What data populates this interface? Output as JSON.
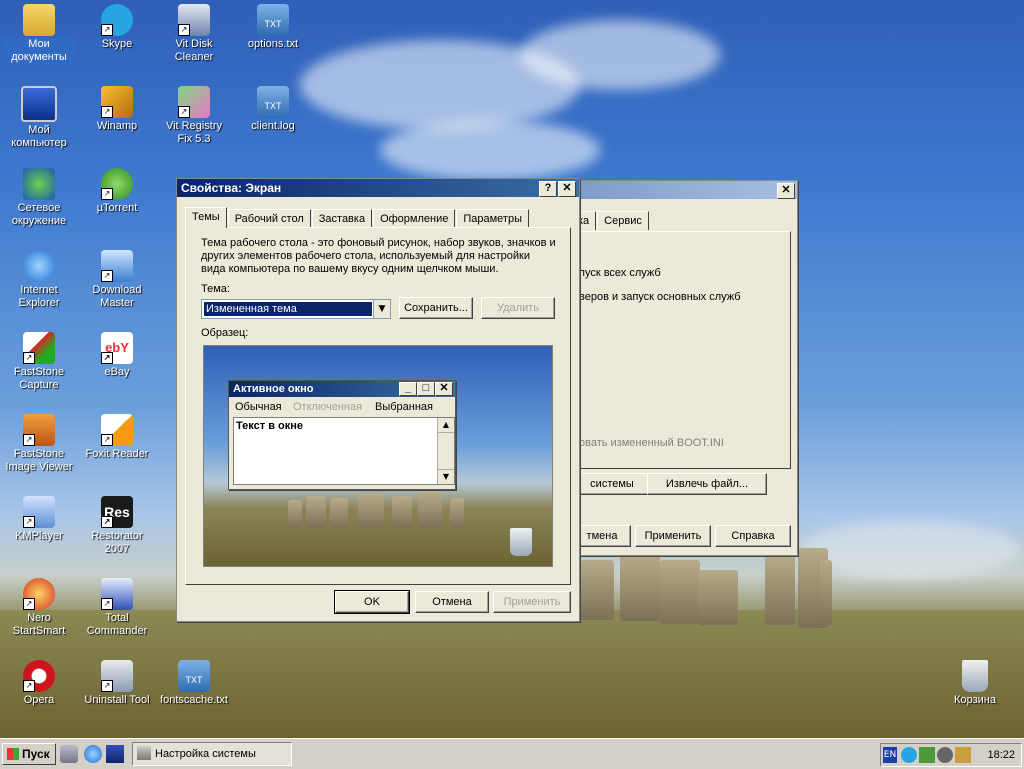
{
  "desktop_icons": [
    {
      "label": "Мои документы",
      "icon": "folder-documents-icon"
    },
    {
      "label": "Skype",
      "icon": "skype-icon"
    },
    {
      "label": "Vit Disk Cleaner",
      "icon": "disk-cleaner-icon"
    },
    {
      "label": "options.txt",
      "icon": "text-file-icon"
    },
    {
      "label": "Мой компьютер",
      "icon": "my-computer-icon"
    },
    {
      "label": "Winamp",
      "icon": "winamp-icon"
    },
    {
      "label": "Vit Registry Fix 5.3",
      "icon": "registry-fix-icon"
    },
    {
      "label": "client.log",
      "icon": "text-file-icon"
    },
    {
      "label": "Сетевое окружение",
      "icon": "network-icon"
    },
    {
      "label": "µTorrent",
      "icon": "utorrent-icon"
    },
    {
      "label": "Internet Explorer",
      "icon": "internet-explorer-icon"
    },
    {
      "label": "Download Master",
      "icon": "download-master-icon"
    },
    {
      "label": "FastStone Capture",
      "icon": "faststone-capture-icon"
    },
    {
      "label": "eBay",
      "icon": "ebay-icon"
    },
    {
      "label": "FastStone Image Viewer",
      "icon": "faststone-viewer-icon"
    },
    {
      "label": "Foxit Reader",
      "icon": "foxit-reader-icon"
    },
    {
      "label": "KMPlayer",
      "icon": "kmplayer-icon"
    },
    {
      "label": "Restorator 2007",
      "icon": "restorator-icon"
    },
    {
      "label": "Nero StartSmart",
      "icon": "nero-icon"
    },
    {
      "label": "Total Commander",
      "icon": "total-commander-icon"
    },
    {
      "label": "Opera",
      "icon": "opera-icon"
    },
    {
      "label": "Uninstall Tool",
      "icon": "uninstall-tool-icon"
    },
    {
      "label": "fontscache.txt",
      "icon": "text-file-icon"
    },
    {
      "label": "Корзина",
      "icon": "recycle-bin-icon"
    }
  ],
  "bg_window": {
    "tab_partial": "ка",
    "tab_service": "Сервис",
    "line1": "пуск всех служб",
    "line2": "веров и запуск основных служб",
    "line3": "овать измененный BOOT.INI",
    "btn_system": "системы",
    "btn_extract": "Извлечь файл...",
    "btn_cancel_partial": "тмена",
    "btn_apply": "Применить",
    "btn_help": "Справка"
  },
  "dialog": {
    "title": "Свойства: Экран",
    "help_btn": "?",
    "close_btn": "✕",
    "tabs": [
      "Темы",
      "Рабочий стол",
      "Заставка",
      "Оформление",
      "Параметры"
    ],
    "description": "Тема рабочего стола - это фоновый рисунок, набор звуков, значков и других элементов рабочего стола, используемый для настройки вида компьютера по вашему вкусу одним щелчком мыши.",
    "theme_label": "Тема:",
    "theme_value": "Измененная тема",
    "save_btn": "Сохранить...",
    "delete_btn": "Удалить",
    "sample_label": "Образец:",
    "preview": {
      "window_title": "Активное окно",
      "menu_normal": "Обычная",
      "menu_disabled": "Отключенная",
      "menu_selected": "Выбранная",
      "window_text": "Текст в окне"
    },
    "ok_btn": "OK",
    "cancel_btn": "Отмена",
    "apply_btn": "Применить"
  },
  "taskbar": {
    "start_label": "Пуск",
    "task_label": "Настройка системы",
    "lang": "EN",
    "clock": "18:22"
  },
  "colors": {
    "title_active": "#0a246a",
    "selection": "#316ac5"
  }
}
